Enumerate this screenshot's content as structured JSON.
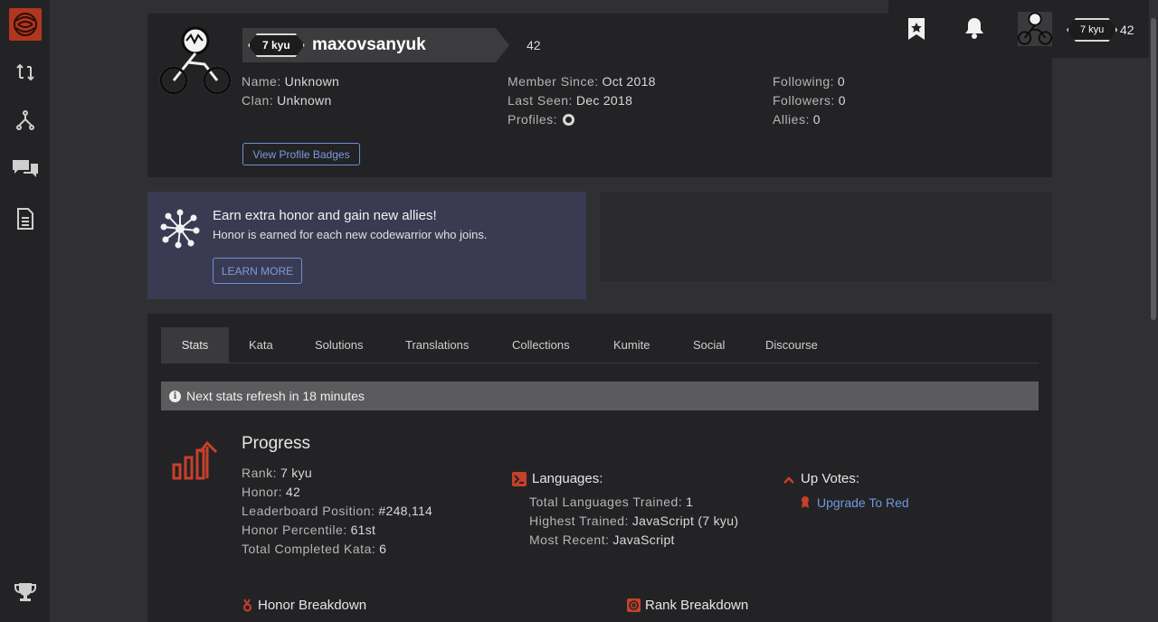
{
  "profile": {
    "rank": "7 kyu",
    "username": "maxovsanyuk",
    "honor": "42",
    "name_label": "Name:",
    "name_value": "Unknown",
    "clan_label": "Clan:",
    "clan_value": "Unknown",
    "member_since_label": "Member Since:",
    "member_since_value": "Oct 2018",
    "last_seen_label": "Last Seen:",
    "last_seen_value": "Dec 2018",
    "profiles_label": "Profiles:",
    "following_label": "Following:",
    "following_value": "0",
    "followers_label": "Followers:",
    "followers_value": "0",
    "allies_label": "Allies:",
    "allies_value": "0",
    "badges_button": "View Profile Badges"
  },
  "topbar": {
    "rank": "7 kyu",
    "honor": "42"
  },
  "promo": {
    "title": "Earn extra honor and gain new allies!",
    "subtitle": "Honor is earned for each new codewarrior who joins.",
    "button": "LEARN MORE"
  },
  "tabs": [
    {
      "label": "Stats"
    },
    {
      "label": "Kata"
    },
    {
      "label": "Solutions"
    },
    {
      "label": "Translations"
    },
    {
      "label": "Collections"
    },
    {
      "label": "Kumite"
    },
    {
      "label": "Social"
    },
    {
      "label": "Discourse"
    }
  ],
  "notice": "Next stats refresh in 18 minutes",
  "progress": {
    "title": "Progress",
    "rank_label": "Rank:",
    "rank_value": "7 kyu",
    "honor_label": "Honor:",
    "honor_value": "42",
    "leaderboard_label": "Leaderboard Position:",
    "leaderboard_value": "#248,114",
    "percentile_label": "Honor Percentile:",
    "percentile_value": "61st",
    "completed_label": "Total Completed Kata:",
    "completed_value": "6"
  },
  "languages": {
    "title": "Languages:",
    "trained_label": "Total Languages Trained:",
    "trained_value": "1",
    "highest_label": "Highest Trained:",
    "highest_value": "JavaScript (7 kyu)",
    "recent_label": "Most Recent:",
    "recent_value": "JavaScript"
  },
  "upvotes": {
    "title": "Up Votes:",
    "link": "Upgrade To Red"
  },
  "breakdowns": {
    "honor": "Honor Breakdown",
    "rank": "Rank Breakdown"
  },
  "colors": {
    "accent_red": "#b1361e",
    "link_blue": "#6f98e0",
    "promo_bg": "#3a3b52"
  }
}
